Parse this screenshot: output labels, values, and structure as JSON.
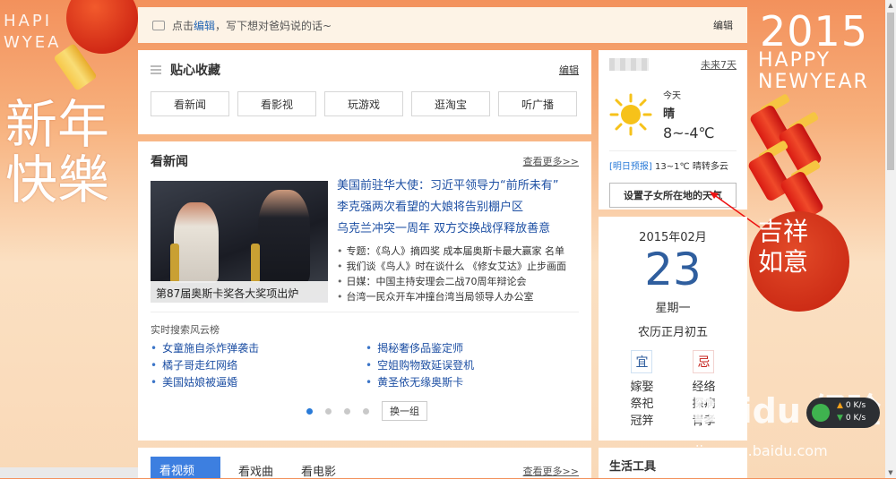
{
  "background": {
    "left_text": "HAPI\nWYEA",
    "left_calligraphy": "新年\n快樂",
    "right_year": "2015",
    "right_text": "HAPPY\nNEWYEAR",
    "right_seal": "吉祥\n如意"
  },
  "message_bar": {
    "prefix": "点击",
    "link": "编辑",
    "suffix": "，写下想对爸妈说的话~",
    "edit_label": "编辑"
  },
  "favorites": {
    "title": "贴心收藏",
    "edit_label": "编辑",
    "buttons": [
      "看新闻",
      "看影视",
      "玩游戏",
      "逛淘宝",
      "听广播"
    ]
  },
  "news": {
    "title": "看新闻",
    "more_label": "查看更多>>",
    "image_caption": "第87届奥斯卡奖各大奖项出炉",
    "headlines": [
      "美国前驻华大使：习近平领导力“前所未有”",
      "李克强两次看望的大娘将告别棚户区",
      "乌克兰冲突一周年 双方交换战俘释放善意"
    ],
    "sub_items": [
      "专题：《鸟人》摘四奖 成本届奥斯卡最大赢家 名单",
      "我们谈《鸟人》时在谈什么 《修女艾达》止步画面",
      "日媒：中国主持安理会二战70周年辩论会",
      "台湾一民众开车冲撞台湾当局领导人办公室"
    ],
    "hot_title": "实时搜索风云榜",
    "hot_left": [
      "女童施自杀炸弹袭击",
      "橘子哥走红网络",
      "美国姑娘被逼婚"
    ],
    "hot_right": [
      "揭秘奢侈品鉴定师",
      "空姐购物致延误登机",
      "黄圣依无缘奥斯卡"
    ],
    "change_label": "换一组",
    "pagination_active": 1
  },
  "bottom_section": {
    "tabs": [
      "看视频",
      "看戏曲",
      "看电影"
    ],
    "more_label": "查看更多>>"
  },
  "weather": {
    "future_link": "未来7天",
    "today_label": "今天",
    "condition": "晴",
    "temperature": "8~-4℃",
    "tomorrow_tag": "[明日预报]",
    "tomorrow_text": "13~1℃ 晴转多云",
    "set_city_button": "设置子女所在地的天气"
  },
  "calendar": {
    "year_month": "2015年02月",
    "day": "23",
    "weekday": "星期一",
    "lunar": "农历正月初五",
    "yi_label": "宜",
    "ji_label": "忌",
    "yi_items": [
      "嫁娶",
      "祭祀",
      "冠笄"
    ],
    "ji_items": [
      "经络",
      "探病",
      "青孝"
    ]
  },
  "life_tools": {
    "title": "生活工具"
  },
  "speed_widget": {
    "up": "0 K/s",
    "down": "0 K/s"
  },
  "watermark": {
    "brand": "Baidu 经验",
    "url": "jingyan.baidu.com"
  },
  "colors": {
    "link_blue": "#1d4fa3",
    "calendar_blue": "#2f5e9e",
    "accent_blue": "#2a7bd8",
    "festive_red": "#d62a17"
  }
}
